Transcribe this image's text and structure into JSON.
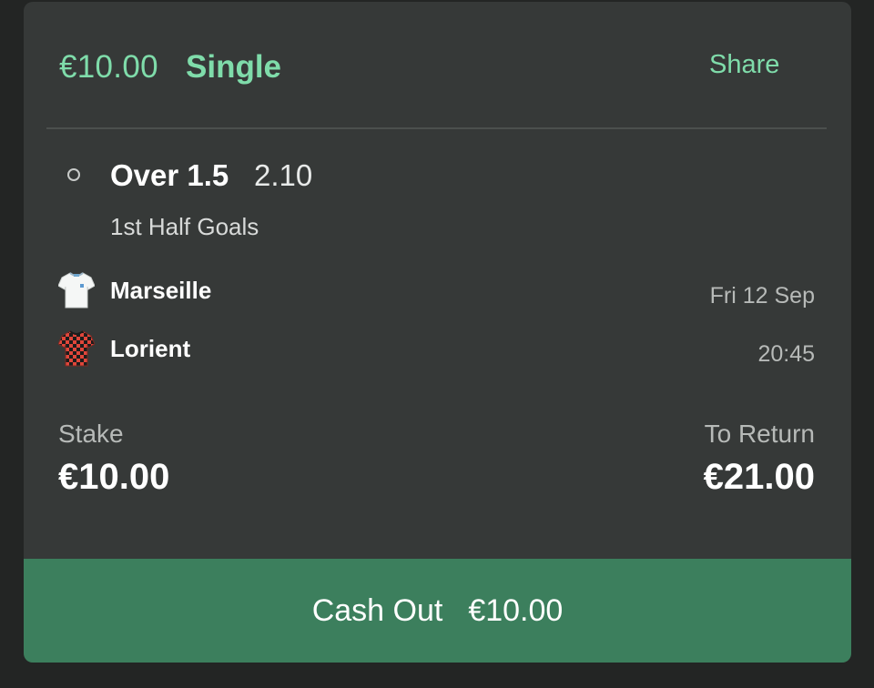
{
  "bet": {
    "amount": "€10.00",
    "type": "Single",
    "share_label": "Share"
  },
  "selection": {
    "name": "Over 1.5",
    "odds": "2.10",
    "market": "1st Half Goals"
  },
  "event": {
    "home_team": "Marseille",
    "away_team": "Lorient",
    "date": "Fri 12 Sep",
    "time": "20:45"
  },
  "stake": {
    "label": "Stake",
    "value": "€10.00"
  },
  "to_return": {
    "label": "To Return",
    "value": "€21.00"
  },
  "cashout": {
    "label": "Cash Out",
    "amount": "€10.00"
  },
  "colors": {
    "accent": "#7fdcaa",
    "card_bg": "#363938",
    "cashout_bg": "#3c7f5d",
    "page_bg": "#232524"
  },
  "icons": {
    "home_kit": "white-shirt-kit-icon",
    "away_kit": "red-black-checkered-kit-icon",
    "selection_status": "open-circle-icon"
  }
}
